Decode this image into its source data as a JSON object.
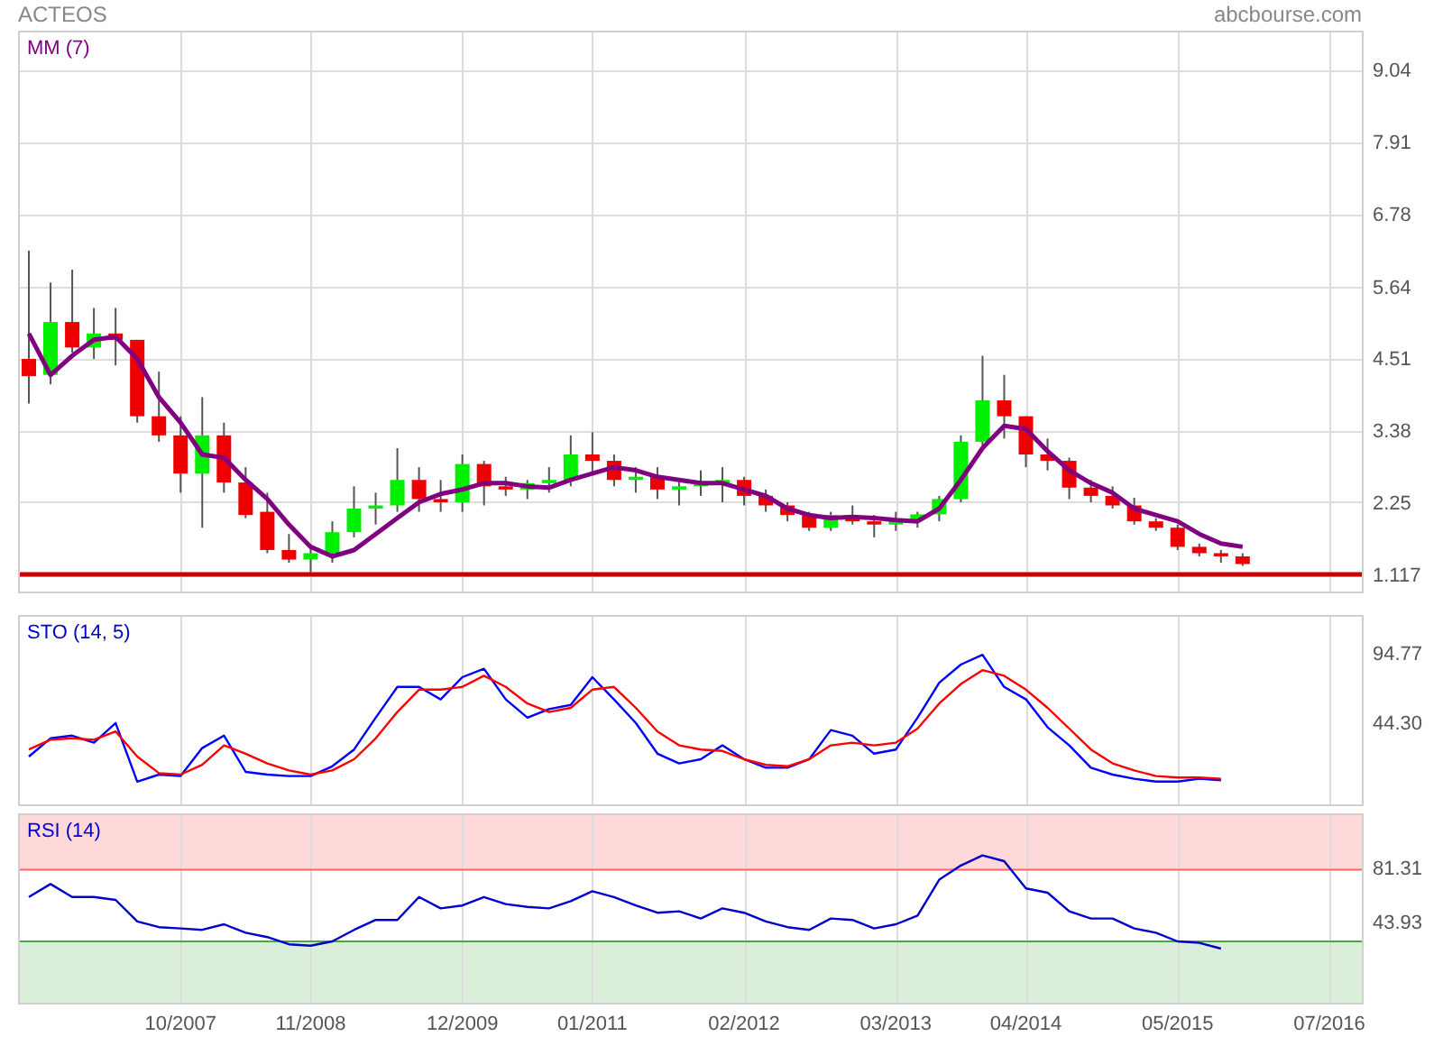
{
  "header": {
    "title": "ACTEOS",
    "source": "abcbourse.com"
  },
  "price_panel": {
    "chart_data": {
      "type": "candlestick",
      "grid": true,
      "ylim": [
        0.834,
        9.64
      ],
      "yticks": [
        1.117,
        2.25,
        3.38,
        4.51,
        5.64,
        6.78,
        7.91,
        9.04
      ],
      "categories": [
        null,
        null,
        null,
        null,
        null,
        null,
        null,
        null,
        null,
        null,
        null,
        null,
        null,
        null,
        null,
        null,
        null,
        null,
        null,
        null,
        null,
        null,
        null,
        null,
        null,
        null,
        null,
        null,
        null,
        null,
        null,
        null,
        null,
        null,
        null,
        null,
        null,
        null,
        null,
        null,
        null,
        null,
        null,
        null,
        null,
        null,
        null,
        null,
        null,
        null,
        null,
        null,
        null,
        null,
        null,
        null,
        null,
        null,
        null,
        null,
        null,
        null
      ],
      "ohlc": [
        [
          4.5,
          6.2,
          3.8,
          4.23
        ],
        [
          4.25,
          5.7,
          4.1,
          5.08
        ],
        [
          5.08,
          5.9,
          4.6,
          4.68
        ],
        [
          4.68,
          5.3,
          4.5,
          4.9
        ],
        [
          4.9,
          5.3,
          4.4,
          4.8
        ],
        [
          4.8,
          4.8,
          3.5,
          3.6
        ],
        [
          3.6,
          4.3,
          3.2,
          3.3
        ],
        [
          3.3,
          3.6,
          2.4,
          2.7
        ],
        [
          2.7,
          3.9,
          1.85,
          3.3
        ],
        [
          3.3,
          3.5,
          2.4,
          2.56
        ],
        [
          2.56,
          2.8,
          2.0,
          2.05
        ],
        [
          2.1,
          2.4,
          1.45,
          1.5
        ],
        [
          1.5,
          1.75,
          1.3,
          1.35
        ],
        [
          1.35,
          1.55,
          1.15,
          1.45
        ],
        [
          1.45,
          1.95,
          1.3,
          1.78
        ],
        [
          1.78,
          2.5,
          1.7,
          2.15
        ],
        [
          2.15,
          2.4,
          1.9,
          2.2
        ],
        [
          2.2,
          3.1,
          2.1,
          2.6
        ],
        [
          2.6,
          2.8,
          2.1,
          2.3
        ],
        [
          2.3,
          2.6,
          2.1,
          2.25
        ],
        [
          2.25,
          3.0,
          2.1,
          2.85
        ],
        [
          2.85,
          2.9,
          2.2,
          2.5
        ],
        [
          2.5,
          2.65,
          2.35,
          2.45
        ],
        [
          2.45,
          2.6,
          2.3,
          2.55
        ],
        [
          2.55,
          2.8,
          2.4,
          2.6
        ],
        [
          2.6,
          3.3,
          2.5,
          3.0
        ],
        [
          3.0,
          3.35,
          2.7,
          2.9
        ],
        [
          2.9,
          3.0,
          2.5,
          2.6
        ],
        [
          2.6,
          2.8,
          2.4,
          2.65
        ],
        [
          2.65,
          2.8,
          2.3,
          2.45
        ],
        [
          2.45,
          2.6,
          2.2,
          2.5
        ],
        [
          2.5,
          2.75,
          2.35,
          2.55
        ],
        [
          2.55,
          2.8,
          2.25,
          2.6
        ],
        [
          2.6,
          2.65,
          2.2,
          2.35
        ],
        [
          2.35,
          2.45,
          2.1,
          2.2
        ],
        [
          2.2,
          2.25,
          1.95,
          2.05
        ],
        [
          2.05,
          2.1,
          1.8,
          1.85
        ],
        [
          1.85,
          2.1,
          1.8,
          2.05
        ],
        [
          2.05,
          2.2,
          1.9,
          1.95
        ],
        [
          1.95,
          2.05,
          1.7,
          1.9
        ],
        [
          1.9,
          2.1,
          1.8,
          1.98
        ],
        [
          1.98,
          2.1,
          1.85,
          2.06
        ],
        [
          2.06,
          2.35,
          1.95,
          2.3
        ],
        [
          2.3,
          3.3,
          2.25,
          3.2
        ],
        [
          3.2,
          4.55,
          3.1,
          3.85
        ],
        [
          3.85,
          4.25,
          3.25,
          3.6
        ],
        [
          3.6,
          3.6,
          2.8,
          3.0
        ],
        [
          3.0,
          3.25,
          2.75,
          2.9
        ],
        [
          2.9,
          2.95,
          2.3,
          2.48
        ],
        [
          2.48,
          2.6,
          2.25,
          2.35
        ],
        [
          2.35,
          2.5,
          2.15,
          2.2
        ],
        [
          2.2,
          2.32,
          1.9,
          1.95
        ],
        [
          1.95,
          2.0,
          1.8,
          1.85
        ],
        [
          1.85,
          1.9,
          1.5,
          1.55
        ],
        [
          1.55,
          1.6,
          1.4,
          1.45
        ],
        [
          1.45,
          1.5,
          1.3,
          1.4
        ],
        [
          1.4,
          1.45,
          1.25,
          1.28
        ],
        null,
        null,
        null,
        null,
        null
      ],
      "series": [
        {
          "name": "MM (7)",
          "type": "line",
          "color": "#800080",
          "values": [
            4.9,
            4.25,
            4.55,
            4.8,
            4.85,
            4.5,
            3.9,
            3.5,
            3.0,
            2.95,
            2.6,
            2.3,
            1.9,
            1.55,
            1.4,
            1.5,
            1.75,
            2.0,
            2.25,
            2.38,
            2.45,
            2.55,
            2.55,
            2.5,
            2.48,
            2.6,
            2.7,
            2.8,
            2.75,
            2.65,
            2.6,
            2.55,
            2.55,
            2.45,
            2.35,
            2.15,
            2.05,
            2.0,
            2.02,
            2.0,
            1.97,
            1.95,
            2.15,
            2.6,
            3.1,
            3.45,
            3.4,
            3.05,
            2.75,
            2.55,
            2.4,
            2.15,
            2.05,
            1.95,
            1.75,
            1.6,
            1.55,
            null,
            null,
            null,
            null,
            null
          ]
        }
      ],
      "ref_lines": [
        {
          "axis": "y",
          "value": 1.117,
          "color": "#cc0000"
        }
      ]
    }
  },
  "sto_panel": {
    "chart_data": {
      "type": "line",
      "title": "STO (14, 5)",
      "grid": true,
      "ylim": [
        -15,
        121
      ],
      "yticks": [
        94.77,
        {
          "value": 44.3,
          "label": "44.30"
        }
      ],
      "categories": [
        null,
        null,
        null,
        null,
        null,
        null,
        null,
        null,
        null,
        null,
        null,
        null,
        null,
        null,
        null,
        null,
        null,
        null,
        null,
        null,
        null,
        null,
        null,
        null,
        null,
        null,
        null,
        null,
        null,
        null,
        null,
        null,
        null,
        null,
        null,
        null,
        null,
        null,
        null,
        null,
        null,
        null,
        null,
        null,
        null,
        null,
        null,
        null,
        null,
        null,
        null,
        null,
        null,
        null,
        null,
        null,
        null,
        null,
        null,
        null,
        null,
        null
      ],
      "series": [
        {
          "color": "#0000ff",
          "values": [
            20,
            33,
            35,
            30,
            44,
            2,
            7,
            6,
            26,
            35,
            9,
            7,
            6,
            6,
            13,
            25,
            48,
            70,
            70,
            61,
            77,
            83,
            61,
            48,
            54,
            57,
            77,
            61,
            44,
            22,
            15,
            18,
            28,
            18,
            12,
            12,
            18,
            39,
            35,
            22,
            25,
            48,
            73,
            86,
            93,
            70,
            61,
            41,
            28,
            12,
            7,
            4,
            2,
            2,
            4,
            3,
            null,
            null,
            null,
            null,
            null,
            null
          ]
        },
        {
          "color": "#ff0000",
          "values": [
            25,
            32,
            33,
            32,
            38,
            20,
            8,
            7,
            14,
            28,
            22,
            15,
            10,
            7,
            10,
            18,
            33,
            52,
            68,
            68,
            70,
            78,
            70,
            58,
            52,
            55,
            68,
            70,
            55,
            38,
            28,
            25,
            24,
            18,
            14,
            13,
            18,
            28,
            30,
            28,
            30,
            40,
            58,
            72,
            82,
            78,
            68,
            55,
            40,
            25,
            15,
            10,
            6,
            5,
            5,
            4,
            null,
            null,
            null,
            null,
            null,
            null
          ]
        }
      ]
    }
  },
  "rsi_panel": {
    "chart_data": {
      "type": "line",
      "title": "RSI (14)",
      "grid": true,
      "ylim": [
        -13.4,
        118.7
      ],
      "yticks": [
        81.31,
        43.93
      ],
      "categories": [
        null,
        null,
        null,
        null,
        null,
        null,
        null,
        "10/2007",
        null,
        null,
        null,
        null,
        null,
        "11/2008",
        null,
        null,
        null,
        null,
        null,
        null,
        "12/2009",
        null,
        null,
        null,
        null,
        null,
        "01/2011",
        null,
        null,
        null,
        null,
        null,
        null,
        "02/2012",
        null,
        null,
        null,
        null,
        null,
        null,
        "03/2013",
        null,
        null,
        null,
        null,
        null,
        "04/2014",
        null,
        null,
        null,
        null,
        null,
        null,
        "05/2015",
        null,
        null,
        null,
        null,
        null,
        null,
        "07/2016",
        null
      ],
      "series": [
        {
          "color": "#0000cc",
          "values": [
            61,
            70,
            61,
            61,
            59,
            44,
            40,
            39,
            38,
            42,
            36,
            33,
            28,
            27,
            30,
            38,
            45,
            45,
            61,
            53,
            55,
            61,
            56,
            54,
            53,
            58,
            65,
            61,
            55,
            50,
            51,
            46,
            53,
            50,
            44,
            40,
            38,
            46,
            45,
            39,
            42,
            48,
            73,
            83,
            90,
            86,
            67,
            64,
            51,
            46,
            46,
            39,
            36,
            30,
            29,
            25,
            null,
            null,
            null,
            null,
            null,
            null
          ]
        }
      ],
      "bands": [
        {
          "axis": "y",
          "from": 80,
          "to": 118.7,
          "color": "#ffd9d9"
        },
        {
          "axis": "y",
          "from": -13.4,
          "to": 30,
          "color": "#daeeda"
        }
      ],
      "ref_lines": [
        {
          "axis": "y",
          "value": 80,
          "color": "#ff6666"
        },
        {
          "axis": "y",
          "value": 30,
          "color": "#44aa44"
        }
      ]
    }
  }
}
